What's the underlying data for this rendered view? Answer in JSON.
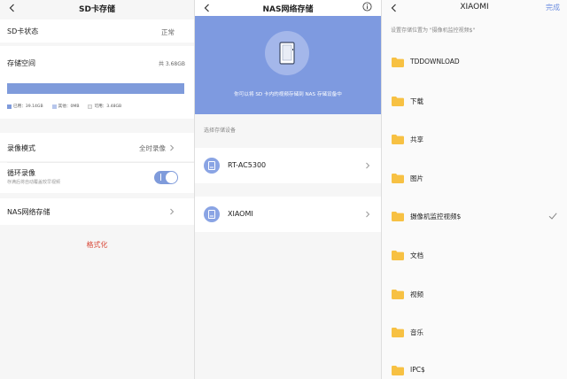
{
  "sd_card": {
    "title": "SD卡存储",
    "status_label": "SD卡状态",
    "status_value": "正常",
    "storage_label": "存储空间",
    "storage_total": "共 3.68GB",
    "used_fraction": 0.99,
    "legend": {
      "used": "已用：39.14GB",
      "other": "其他：0MB",
      "free": "可用：3.48GB"
    },
    "record_mode_label": "录像模式",
    "record_mode_value": "全时录像",
    "loop_label": "循环录像",
    "loop_sub": "存满后将自动覆盖较早视频",
    "loop_on": true,
    "nas_label": "NAS网络存储",
    "format_label": "格式化"
  },
  "nas": {
    "title": "NAS网络存储",
    "hero_message": "你可以将 SD 卡内的视频存储到 NAS 存储设备中",
    "section_label": "选择存储设备",
    "devices": [
      {
        "name": "RT-AC5300"
      },
      {
        "name": "XIAOMI"
      }
    ]
  },
  "folder_picker": {
    "title": "XIAOMI",
    "done_label": "完成",
    "hint": "设置存储位置为 \"摄像机监控视频$\"",
    "folders": [
      {
        "name": "TDDOWNLOAD",
        "selected": false
      },
      {
        "name": "下载",
        "selected": false
      },
      {
        "name": "共享",
        "selected": false
      },
      {
        "name": "图片",
        "selected": false
      },
      {
        "name": "摄像机监控视频$",
        "selected": true
      },
      {
        "name": "文档",
        "selected": false
      },
      {
        "name": "视频",
        "selected": false
      },
      {
        "name": "音乐",
        "selected": false
      },
      {
        "name": "IPC$",
        "selected": false
      }
    ]
  },
  "colors": {
    "accent": "#7f9bdb",
    "folder": "#f7c143",
    "danger": "#d94a3a"
  },
  "icons": {
    "back": "chevron-left-icon",
    "chevron": "chevron-right-icon",
    "info": "info-icon",
    "nas": "nas-device-icon",
    "drive": "drive-icon",
    "folder": "folder-icon",
    "check": "check-icon"
  }
}
